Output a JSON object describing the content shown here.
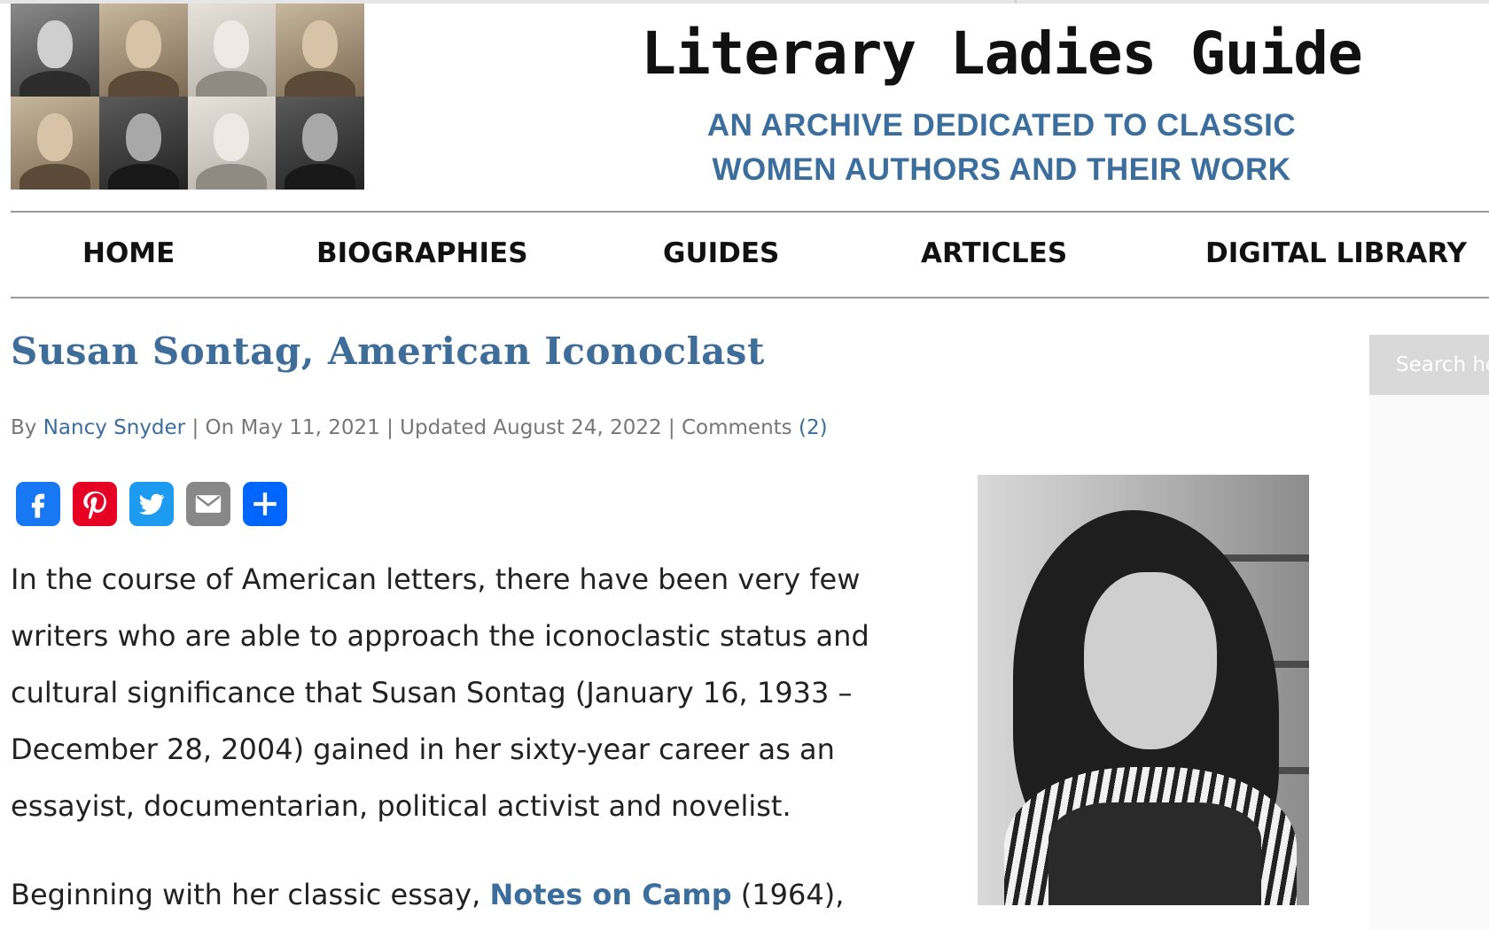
{
  "site": {
    "title": "Literary Ladies Guide",
    "tagline_line1": "AN ARCHIVE DEDICATED TO CLASSIC",
    "tagline_line2": "WOMEN AUTHORS AND THEIR WORK",
    "accent_color": "#3b6e9c"
  },
  "nav": {
    "items": [
      {
        "label": "HOME"
      },
      {
        "label": "BIOGRAPHIES"
      },
      {
        "label": "GUIDES"
      },
      {
        "label": "ARTICLES"
      },
      {
        "label": "DIGITAL LIBRARY"
      }
    ]
  },
  "post": {
    "title": "Susan Sontag, American Iconoclast",
    "meta": {
      "by": "By",
      "author": "Nancy Snyder",
      "date": "| On May 11, 2021 | Updated August 24, 2022 | Comments",
      "comments": "(2)"
    },
    "share_icons": [
      {
        "name": "facebook-icon",
        "color": "#1877f2"
      },
      {
        "name": "pinterest-icon",
        "color": "#e60023"
      },
      {
        "name": "twitter-icon",
        "color": "#1d9bf0"
      },
      {
        "name": "email-icon",
        "color": "#888888"
      },
      {
        "name": "share-icon",
        "color": "#0166ff"
      }
    ],
    "paragraph1": "In the course of American letters, there have been very few writers who are able to approach the iconoclastic status and cultural significance that Susan Sontag (January 16, 1933 – December 28, 2004) gained in her sixty-year career as an essayist, documentarian, political activist and novelist.",
    "paragraph2_start": "Beginning with her classic essay, ",
    "paragraph2_link": "Notes on Camp",
    "paragraph2_end": " (1964),"
  },
  "sidebar": {
    "search_placeholder": "Search here..."
  }
}
